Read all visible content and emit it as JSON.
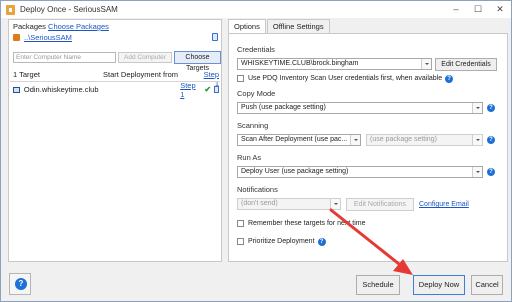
{
  "window": {
    "title": "Deploy Once - SeriousSAM"
  },
  "left": {
    "packages_label": "Packages",
    "choose_packages": "Choose Packages",
    "package_name": "..\\SeriousSAM",
    "computer_placeholder": "Enter Computer Name",
    "add_computer": "Add Computer",
    "choose_targets": "Choose Targets",
    "targets_count": "1 Target",
    "start_from": "Start Deployment from",
    "step": "Step 1",
    "targets": [
      {
        "name": "Odin.whiskeytime.club",
        "step": "Step 1"
      }
    ]
  },
  "tabs": [
    {
      "label": "Options"
    },
    {
      "label": "Offline Settings"
    }
  ],
  "options": {
    "credentials_label": "Credentials",
    "credentials_value": "WHISKEYTIME.CLUB\\brock.bingham",
    "edit_credentials": "Edit Credentials",
    "use_inventory_scan": "Use PDQ Inventory Scan User credentials first, when available",
    "copy_mode_label": "Copy Mode",
    "copy_mode_value": "Push (use package setting)",
    "scanning_label": "Scanning",
    "scanning_value": "Scan After Deployment (use pac...",
    "scanning_profile_placeholder": "(use package setting)",
    "run_as_label": "Run As",
    "run_as_value": "Deploy User (use package setting)",
    "notifications_label": "Notifications",
    "notifications_value": "(don't send)",
    "edit_notifications": "Edit Notifications",
    "configure_email": "Configure Email",
    "remember_targets": "Remember these targets for next time",
    "prioritize": "Prioritize Deployment"
  },
  "footer": {
    "schedule": "Schedule",
    "deploy_now": "Deploy Now",
    "cancel": "Cancel"
  },
  "colors": {
    "link": "#1a56c4",
    "help": "#1e6fd6",
    "annotation_arrow": "#e53935"
  }
}
